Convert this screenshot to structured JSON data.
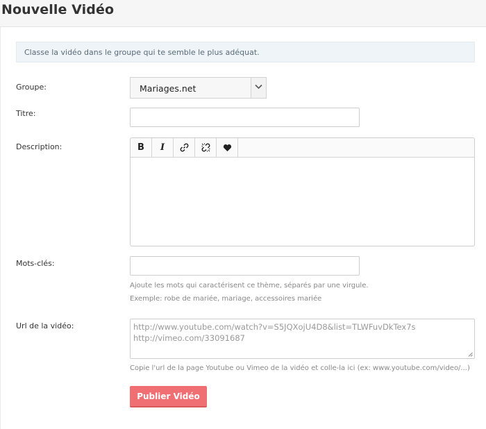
{
  "page": {
    "title": "Nouvelle Vidéo"
  },
  "info": {
    "text": "Classe la vidéo dans le groupe qui te semble le plus adéquat."
  },
  "form": {
    "group": {
      "label": "Groupe:",
      "value": "Mariages.net"
    },
    "title": {
      "label": "Titre:",
      "value": ""
    },
    "description": {
      "label": "Description:",
      "toolbar": {
        "bold": "B",
        "italic": "I",
        "icons": [
          "link-icon",
          "unlink-icon",
          "heart-icon"
        ]
      }
    },
    "keywords": {
      "label": "Mots-clés:",
      "value": "",
      "help1": "Ajoute les mots qui caractérisent ce thème, séparés par une virgule.",
      "help2": "Exemple: robe de mariée, mariage, accessoires mariée"
    },
    "url": {
      "label": "Url de la vidéo:",
      "placeholder_line1": "http://www.youtube.com/watch?v=S5JQXojU4D8&list=TLWFuvDkTex7s",
      "placeholder_line2": "http://vimeo.com/33091687",
      "help": "Copie l'url de la page Youtube ou Vimeo de la vidéo et colle-la ici (ex: www.youtube.com/video/...)"
    },
    "submit_label": "Publier Vidéo"
  },
  "colors": {
    "accent": "#ef6f72",
    "info_bg": "#eef4f8"
  }
}
